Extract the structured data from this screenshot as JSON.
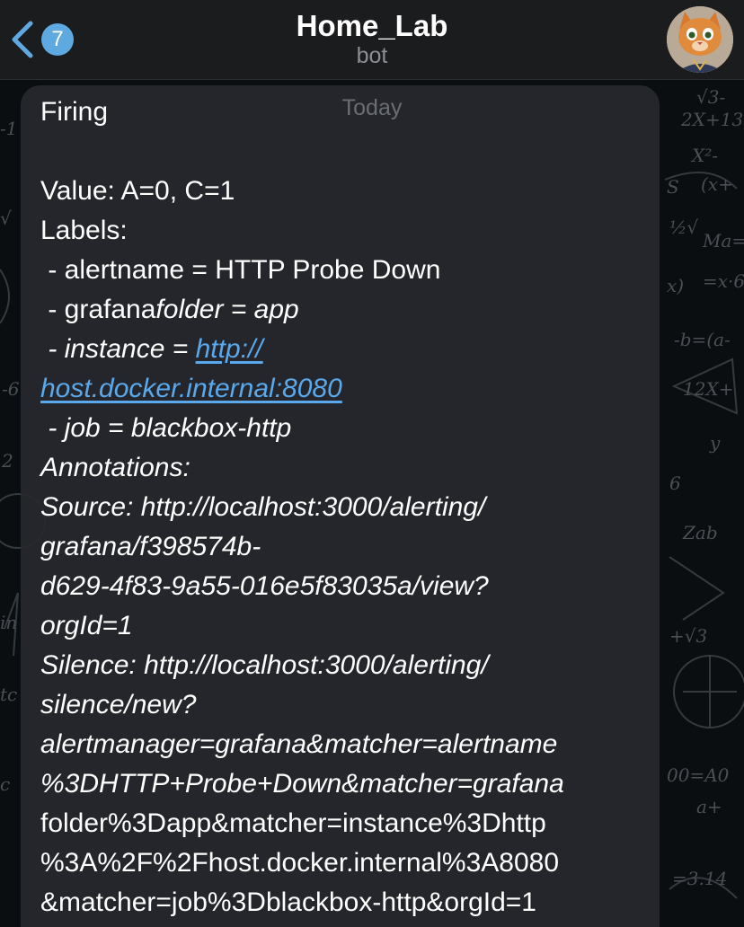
{
  "header": {
    "unread_count": "7",
    "title": "Home_Lab",
    "subtitle": "bot"
  },
  "chat": {
    "date_label": "Today"
  },
  "message": {
    "status": "Firing",
    "value": "Value: A=0, C=1",
    "labels_heading": "Labels:",
    "alertname": " - alertname = HTTP Probe Down",
    "grafana_prefix": " - grafana",
    "grafana_suffix": "folder = app",
    "instance_prefix": " - instance = ",
    "instance_link_part1": "http://",
    "instance_link_part2": "host.docker.internal:8080",
    "job": " - job = blackbox-http",
    "annotations_heading": "Annotations:",
    "source_line1": "Source: http://localhost:3000/alerting/",
    "source_line2": "grafana/f398574b-",
    "source_line3": "d629-4f83-9a55-016e5f83035a/view?",
    "source_line4": "orgId=1",
    "silence_line1": "Silence: http://localhost:3000/alerting/",
    "silence_line2": "silence/new?",
    "silence_line3": "alertmanager=grafana&matcher=alertname",
    "silence_line4": "%3DHTTP+Probe+Down&matcher=grafana",
    "silence_line5": "folder%3Dapp&matcher=instance%3Dhttp",
    "silence_line6": "%3A%2F%2Fhost.docker.internal%3A8080",
    "silence_line7": "&matcher=job%3Dblackbox-http&orgId=1"
  },
  "colors": {
    "accent": "#5da9e0",
    "link": "#5aa9ec",
    "header_bg": "#1b1c1e",
    "bubble_bg": "#26282d"
  }
}
